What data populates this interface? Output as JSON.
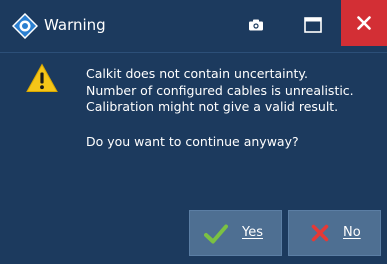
{
  "window": {
    "title": "Warning",
    "app_icon": "rohde-schwarz-logo-icon",
    "controls": {
      "screenshot": "camera-icon",
      "maximize": "maximize-icon",
      "close": "close-icon"
    }
  },
  "message": {
    "icon": "warning-triangle-icon",
    "lines": [
      "Calkit does not contain uncertainty.",
      "Number of configured cables is unrealistic.",
      "Calibration might not give a valid result."
    ],
    "question": "Do you want to continue anyway?"
  },
  "buttons": {
    "yes": {
      "label": "Yes",
      "icon": "checkmark-icon"
    },
    "no": {
      "label": "No",
      "icon": "x-mark-icon"
    }
  },
  "colors": {
    "background": "#1c3a5e",
    "close_button": "#d32f35",
    "button_face": "#4e6f92",
    "warning_yellow": "#f5c518",
    "check_green": "#7bc142",
    "x_red": "#e53935"
  }
}
